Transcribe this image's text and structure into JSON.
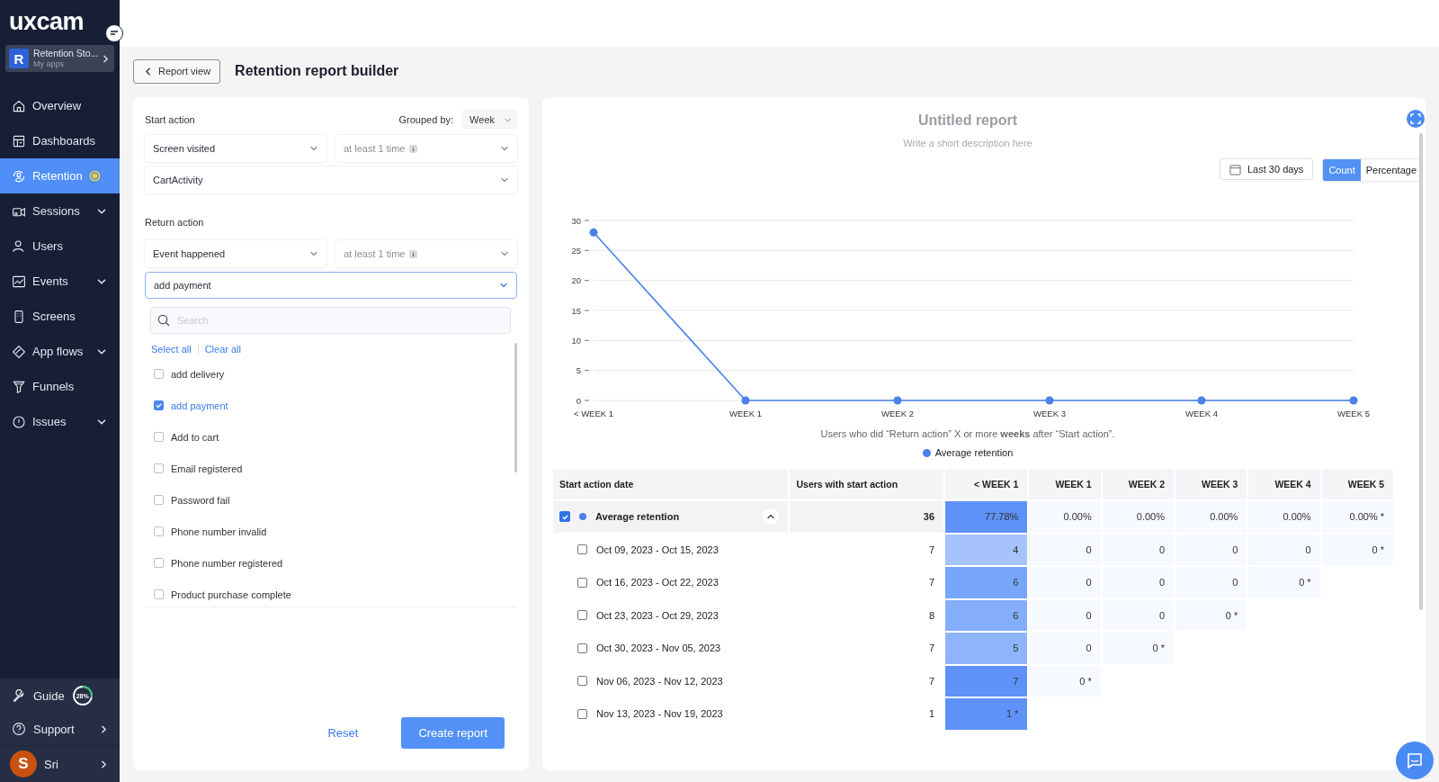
{
  "sidebar": {
    "logo": "uxcam",
    "app": {
      "initial": "R",
      "name": "Retention Sto...",
      "subtitle": "My apps"
    },
    "items": [
      {
        "label": "Overview",
        "kind": "home",
        "selected": false,
        "expandable": false,
        "badge": false
      },
      {
        "label": "Dashboards",
        "kind": "dashboard",
        "selected": false,
        "expandable": false,
        "badge": false
      },
      {
        "label": "Retention",
        "kind": "retention",
        "selected": true,
        "expandable": false,
        "badge": true
      },
      {
        "label": "Sessions",
        "kind": "sessions",
        "selected": false,
        "expandable": true,
        "badge": false
      },
      {
        "label": "Users",
        "kind": "users",
        "selected": false,
        "expandable": false,
        "badge": false
      },
      {
        "label": "Events",
        "kind": "events",
        "selected": false,
        "expandable": true,
        "badge": false
      },
      {
        "label": "Screens",
        "kind": "screens",
        "selected": false,
        "expandable": false,
        "badge": false
      },
      {
        "label": "App flows",
        "kind": "flows",
        "selected": false,
        "expandable": true,
        "badge": false
      },
      {
        "label": "Funnels",
        "kind": "funnels",
        "selected": false,
        "expandable": false,
        "badge": false
      },
      {
        "label": "Issues",
        "kind": "issues",
        "selected": false,
        "expandable": true,
        "badge": false
      }
    ],
    "footer": {
      "guide": {
        "label": "Guide",
        "progress": "28%",
        "level": 0.28
      },
      "support": "Support",
      "user": {
        "initial": "S",
        "name": "Sri"
      }
    }
  },
  "header": {
    "back_button": "Report view",
    "title": "Retention report builder"
  },
  "builder": {
    "start_action": {
      "label": "Start action",
      "grouped_by_label": "Grouped by:",
      "grouped_by": "Week",
      "type": "Screen visited",
      "frequency": "at least 1 time",
      "target": "CartActivity"
    },
    "return_action": {
      "label": "Return action",
      "type": "Event happened",
      "frequency": "at least 1 time",
      "target": "add payment",
      "open": true,
      "search_placeholder": "Search",
      "select_all": "Select all",
      "clear_all": "Clear all",
      "options": [
        {
          "label": "add delivery",
          "checked": false
        },
        {
          "label": "add payment",
          "checked": true
        },
        {
          "label": "Add to cart",
          "checked": false
        },
        {
          "label": "Email registered",
          "checked": false
        },
        {
          "label": "Password fail",
          "checked": false
        },
        {
          "label": "Phone number invalid",
          "checked": false
        },
        {
          "label": "Phone number registered",
          "checked": false
        },
        {
          "label": "Product purchase complete",
          "checked": false
        }
      ]
    },
    "reset": "Reset",
    "create": "Create report"
  },
  "report": {
    "title": "Untitled report",
    "description": "Write a short description here",
    "date_range": "Last 30 days",
    "modes": [
      {
        "label": "Count",
        "selected": true
      },
      {
        "label": "Percentage",
        "selected": false
      }
    ],
    "chart_data": {
      "type": "line",
      "categories": [
        "< WEEK 1",
        "WEEK 1",
        "WEEK 2",
        "WEEK 3",
        "WEEK 4",
        "WEEK 5"
      ],
      "series": [
        {
          "name": "Average retention",
          "color": "#4a80e8",
          "marker": true,
          "values": [
            28,
            0,
            0,
            0,
            0,
            0
          ]
        }
      ],
      "ylim": [
        0,
        30
      ],
      "yticks": [
        0,
        5,
        10,
        15,
        20,
        25,
        30
      ],
      "grid": true
    },
    "caption": "Users who did “Return action” X or more **weeks** after “Start action”.",
    "table": {
      "columns": [
        "Start action date",
        "Users with start action",
        "< WEEK 1",
        "WEEK 1",
        "WEEK 2",
        "WEEK 3",
        "WEEK 4",
        "WEEK 5"
      ],
      "summary": {
        "checked": true,
        "color": "#4a80e8",
        "expanded": true,
        "cells": [
          {
            "text": "Average retention"
          },
          {
            "text": "36"
          },
          {
            "text": "77.78%",
            "color": "#5e92f9"
          },
          {
            "text": "0.00%",
            "color": "#f6f9ff"
          },
          {
            "text": "0.00%",
            "color": "#f6f9ff"
          },
          {
            "text": "0.00%",
            "color": "#f6f9ff"
          },
          {
            "text": "0.00%",
            "color": "#f6f9ff"
          },
          {
            "text": "0.00% *",
            "color": "#f6f9ff"
          }
        ]
      },
      "rows": [
        {
          "checked": false,
          "cells": [
            {
              "text": "Oct 09, 2023 - Oct 15, 2023"
            },
            {
              "text": "7"
            },
            {
              "text": "4",
              "color": "#a6c3fb"
            },
            {
              "text": "0",
              "color": "#f6f9ff"
            },
            {
              "text": "0",
              "color": "#f6f9ff"
            },
            {
              "text": "0",
              "color": "#f6f9ff"
            },
            {
              "text": "0",
              "color": "#f6f9ff"
            },
            {
              "text": "0 *",
              "color": "#f6f9ff"
            }
          ]
        },
        {
          "checked": false,
          "cells": [
            {
              "text": "Oct 16, 2023 - Oct 22, 2023"
            },
            {
              "text": "7"
            },
            {
              "text": "6",
              "color": "#78a6fa"
            },
            {
              "text": "0",
              "color": "#f6f9ff"
            },
            {
              "text": "0",
              "color": "#f6f9ff"
            },
            {
              "text": "0",
              "color": "#f6f9ff"
            },
            {
              "text": "0 *",
              "color": "#f6f9ff"
            }
          ]
        },
        {
          "checked": false,
          "cells": [
            {
              "text": "Oct 23, 2023 - Oct 29, 2023"
            },
            {
              "text": "8"
            },
            {
              "text": "6",
              "color": "#85aefa"
            },
            {
              "text": "0",
              "color": "#f6f9ff"
            },
            {
              "text": "0",
              "color": "#f6f9ff"
            },
            {
              "text": "0 *",
              "color": "#f6f9ff"
            }
          ]
        },
        {
          "checked": false,
          "cells": [
            {
              "text": "Oct 30, 2023 - Nov 05, 2023"
            },
            {
              "text": "7"
            },
            {
              "text": "5",
              "color": "#8fb4fa"
            },
            {
              "text": "0",
              "color": "#f6f9ff"
            },
            {
              "text": "0 *",
              "color": "#f6f9ff"
            }
          ]
        },
        {
          "checked": false,
          "cells": [
            {
              "text": "Nov 06, 2023 - Nov 12, 2023"
            },
            {
              "text": "7"
            },
            {
              "text": "7",
              "color": "#5e92f9"
            },
            {
              "text": "0 *",
              "color": "#f6f9ff"
            }
          ]
        },
        {
          "checked": false,
          "cells": [
            {
              "text": "Nov 13, 2023 - Nov 19, 2023"
            },
            {
              "text": "1"
            },
            {
              "text": "1 *",
              "color": "#5e92f9"
            }
          ]
        }
      ]
    }
  }
}
